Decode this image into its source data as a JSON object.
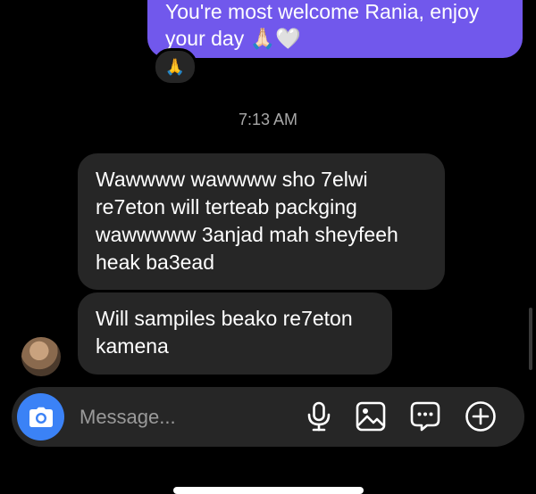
{
  "messages": {
    "outgoing": {
      "lines": [
        "You're most welcome Rania, enjoy",
        "your day 🙏🏻🤍"
      ],
      "reaction": "🙏"
    },
    "timestamp": "7:13 AM",
    "incoming": [
      {
        "lines": [
          "Wawwww wawwww sho 7elwi",
          "re7eton will terteab packging",
          "wawwwww 3anjad mah sheyfeeh",
          "heak ba3ead"
        ]
      },
      {
        "lines": [
          "Will sampiles beako re7eton",
          "kamena"
        ]
      }
    ]
  },
  "composer": {
    "placeholder": "Message...",
    "icons": [
      "camera-icon",
      "microphone-icon",
      "gallery-icon",
      "sticker-icon",
      "plus-icon"
    ]
  },
  "colors": {
    "outgoing_bubble": "#7158ec",
    "incoming_bubble": "#262626",
    "camera_button": "#3b82f6",
    "background": "#000000"
  }
}
